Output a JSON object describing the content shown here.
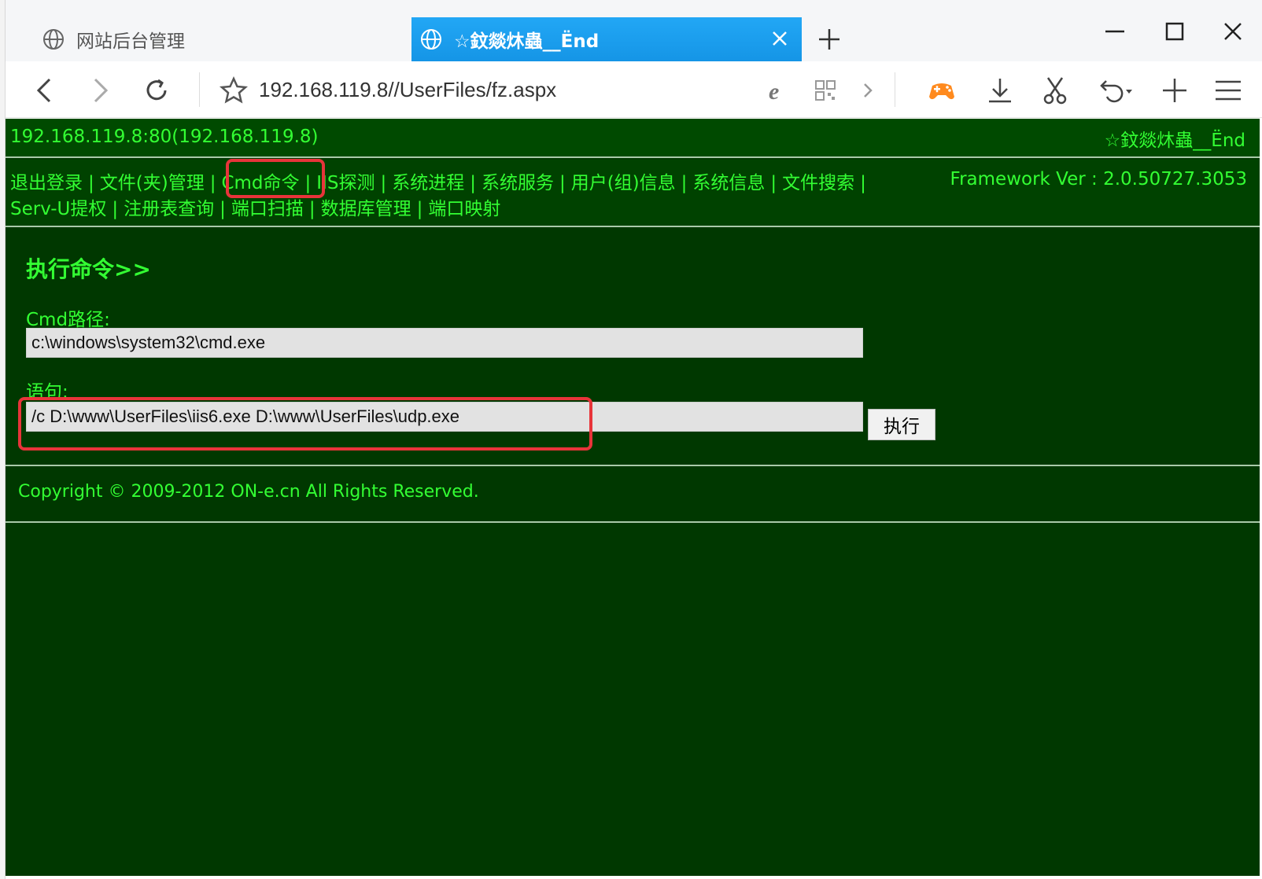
{
  "browser": {
    "tabs": [
      {
        "title": "网站后台管理",
        "active": false
      },
      {
        "title": "☆鈫燚炑蟲__Ënd",
        "active": true
      }
    ],
    "address": "192.168.119.8//UserFiles/fz.aspx"
  },
  "page": {
    "host_info": "192.168.119.8:80(192.168.119.8)",
    "site_name": "☆鈫燚炑蟲__Ënd",
    "framework": "Framework Ver : 2.0.50727.3053",
    "menu_row1": [
      "退出登录",
      "文件(夹)管理",
      "Cmd命令",
      "IIS探测",
      "系统进程",
      "系统服务",
      "用户(组)信息",
      "系统信息",
      "文件搜索"
    ],
    "menu_row2": [
      "Serv-U提权",
      "注册表查询",
      "端口扫描",
      "数据库管理",
      "端口映射"
    ],
    "section_title": "执行命令>>",
    "cmd_path_label": "Cmd路径:",
    "cmd_path_value": "c:\\windows\\system32\\cmd.exe",
    "statement_label": "语句:",
    "statement_value": "/c D:\\www\\UserFiles\\iis6.exe D:\\www\\UserFiles\\udp.exe",
    "execute_button": "执行",
    "copyright": "Copyright © 2009-2012 ON-e.cn All Rights Reserved."
  },
  "colors": {
    "page_background": "#003800",
    "link_green": "#33ff33",
    "active_tab": "#1da1f2",
    "highlight": "#e8343a"
  }
}
